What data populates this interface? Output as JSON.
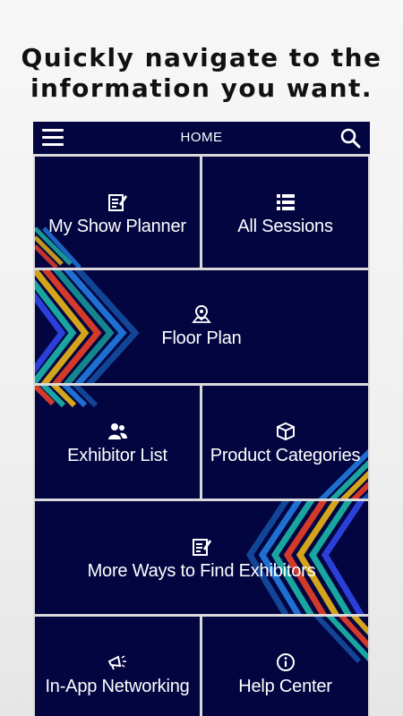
{
  "promo": {
    "line1": "Quickly navigate to the",
    "line2": "information you want."
  },
  "header": {
    "title": "HOME",
    "menu_icon": "hamburger-menu-icon",
    "search_icon": "search-icon"
  },
  "tiles": [
    {
      "label": "My Show Planner",
      "icon": "planner-icon"
    },
    {
      "label": "All Sessions",
      "icon": "list-icon"
    },
    {
      "label": "Floor Plan",
      "icon": "map-pin-icon"
    },
    {
      "label": "Exhibitor List",
      "icon": "people-icon"
    },
    {
      "label": "Product Categories",
      "icon": "box-icon"
    },
    {
      "label": "More Ways to Find Exhibitors",
      "icon": "planner-icon"
    },
    {
      "label": "In-App Networking",
      "icon": "megaphone-icon"
    },
    {
      "label": "Help Center",
      "icon": "info-icon"
    }
  ],
  "colors": {
    "navy": "#020540",
    "stripes": [
      "#2b3fd9",
      "#1aa6a0",
      "#d4a51a",
      "#d43a2a",
      "#1f6fd1"
    ]
  }
}
